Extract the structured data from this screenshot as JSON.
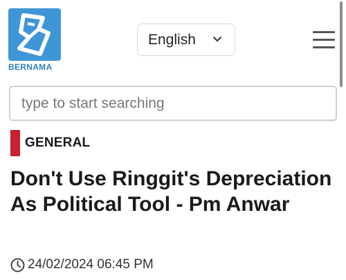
{
  "header": {
    "logo_text": "BERNAMA",
    "language": {
      "selected": "English"
    },
    "menu_icon": "hamburger-menu-icon"
  },
  "search": {
    "placeholder": "type to start searching",
    "value": ""
  },
  "article": {
    "category": "GENERAL",
    "title": "Don't Use Ringgit's Depreciation As Political Tool - Pm Anwar",
    "datetime": "24/02/2024 06:45 PM"
  },
  "colors": {
    "brand_blue": "#3f96d6",
    "category_accent": "#c8202f"
  }
}
